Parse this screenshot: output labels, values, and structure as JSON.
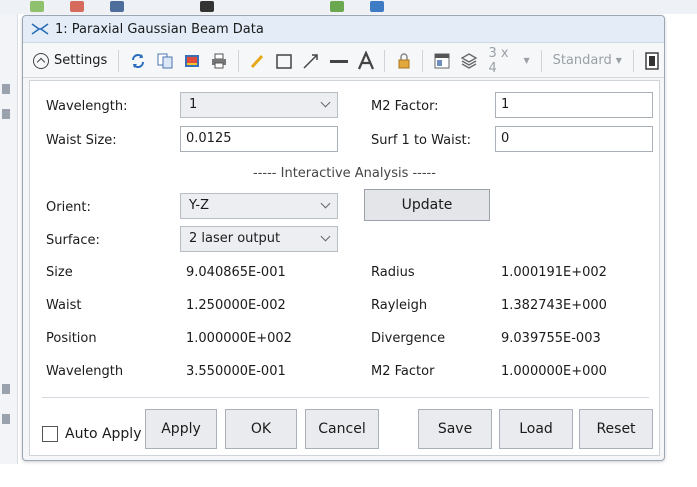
{
  "window": {
    "title": "1: Paraxial Gaussian Beam Data"
  },
  "toolbar": {
    "settings_label": "Settings",
    "layout_label": "3 x 4",
    "style_label": "Standard",
    "icons": [
      "refresh-icon",
      "copy-icon",
      "export-icon",
      "print-icon",
      "pencil-icon",
      "rectangle-icon",
      "arrow-icon",
      "line-icon",
      "text-icon",
      "lock-icon",
      "window-icon",
      "layers-icon",
      "exit-icon"
    ]
  },
  "inputs": {
    "wavelength_label": "Wavelength:",
    "wavelength_value": "1",
    "m2_label": "M2 Factor:",
    "m2_value": "1",
    "waist_label": "Waist Size:",
    "waist_value": "0.0125",
    "surf1_label": "Surf 1 to Waist:",
    "surf1_value": "0"
  },
  "interactive": {
    "title": "----- Interactive Analysis -----",
    "orient_label": "Orient:",
    "orient_value": "Y-Z",
    "surface_label": "Surface:",
    "surface_value": "2 laser output",
    "update_label": "Update"
  },
  "results": {
    "left": [
      {
        "label": "Size",
        "value": "9.040865E-001"
      },
      {
        "label": "Waist",
        "value": "1.250000E-002"
      },
      {
        "label": "Position",
        "value": "1.000000E+002"
      },
      {
        "label": "Wavelength",
        "value": "3.550000E-001"
      }
    ],
    "right": [
      {
        "label": "Radius",
        "value": "1.000191E+002"
      },
      {
        "label": "Rayleigh",
        "value": "1.382743E+000"
      },
      {
        "label": "Divergence",
        "value": "9.039755E-003"
      },
      {
        "label": "M2 Factor",
        "value": "1.000000E+000"
      }
    ]
  },
  "footer": {
    "auto_apply_label": "Auto Apply",
    "apply_label": "Apply",
    "ok_label": "OK",
    "cancel_label": "Cancel",
    "save_label": "Save",
    "load_label": "Load",
    "reset_label": "Reset"
  },
  "colors": {
    "titlebar": "#e3ecf7",
    "panel": "#ffffff",
    "button": "#e9ebee",
    "accent_blue": "#2a6ebb"
  }
}
